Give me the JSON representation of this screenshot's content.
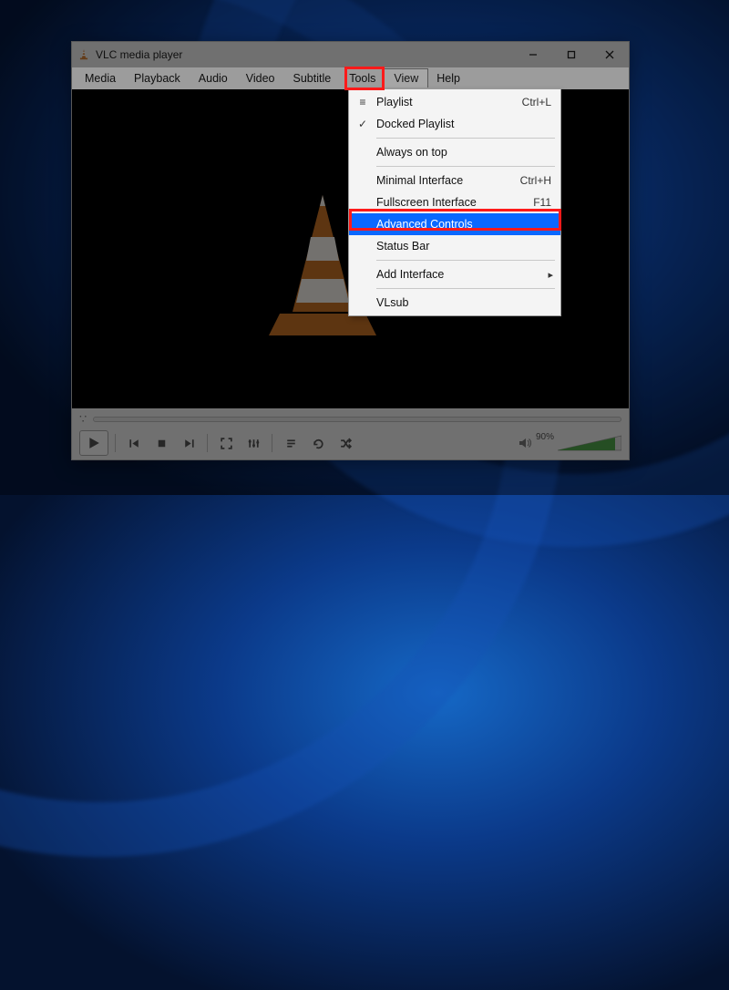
{
  "title": "VLC media player",
  "menus": {
    "media": "Media",
    "playback": "Playback",
    "audio": "Audio",
    "video": "Video",
    "subtitle": "Subtitle",
    "tools": "Tools",
    "view": "View",
    "help": "Help"
  },
  "view_menu": {
    "playlist": {
      "label": "Playlist",
      "accel": "Ctrl+L"
    },
    "docked": {
      "label": "Docked Playlist"
    },
    "always_on_top": {
      "label": "Always on top"
    },
    "minimal": {
      "label": "Minimal Interface",
      "accel": "Ctrl+H"
    },
    "fullscreen": {
      "label": "Fullscreen Interface",
      "accel": "F11"
    },
    "advanced": {
      "label": "Advanced Controls"
    },
    "status_bar": {
      "label": "Status Bar"
    },
    "add_interface": {
      "label": "Add Interface"
    },
    "vlsub": {
      "label": "VLsub"
    }
  },
  "seek": {
    "elapsed": "--:--",
    "remaining": "--:--"
  },
  "volume": {
    "percent": "90%"
  }
}
